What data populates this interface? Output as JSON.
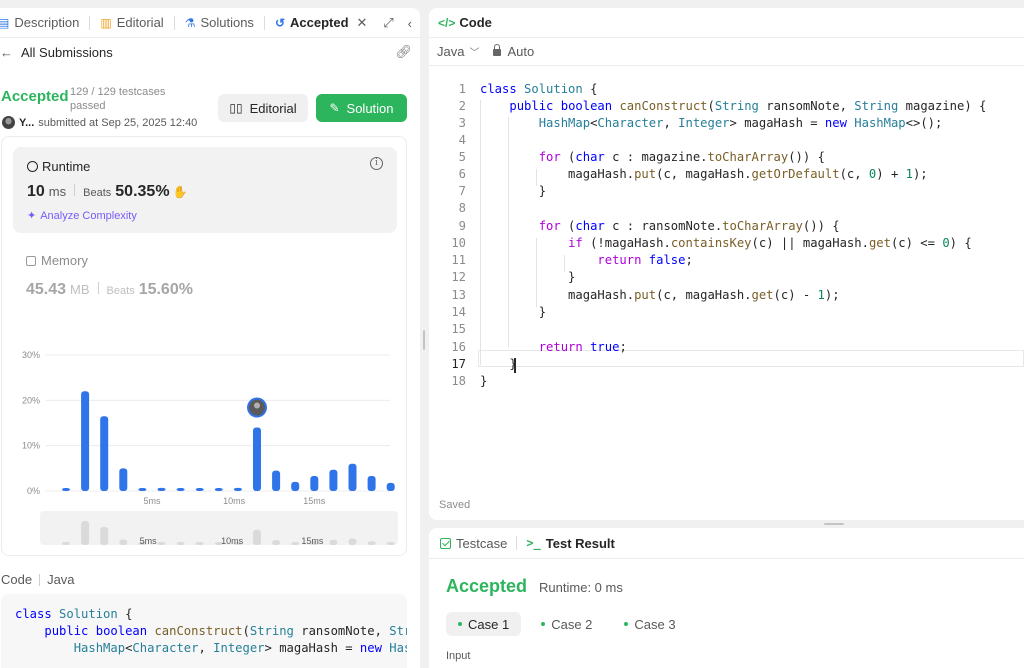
{
  "tabs": {
    "description": "Description",
    "editorial": "Editorial",
    "solutions": "Solutions",
    "accepted": "Accepted"
  },
  "submissions": {
    "back_label": "All Submissions"
  },
  "result": {
    "status": "Accepted",
    "testcases": "129 / 129 testcases passed",
    "user": "Y...",
    "submitted": "submitted at Sep 25, 2025 12:40",
    "editorial_btn": "Editorial",
    "solution_btn": "Solution"
  },
  "runtime": {
    "title": "Runtime",
    "value": "10",
    "unit": "ms",
    "beats_label": "Beats",
    "beats_pct": "50.35%",
    "analyze": "Analyze Complexity"
  },
  "memory": {
    "title": "Memory",
    "value": "45.43",
    "unit": "MB",
    "beats_label": "Beats",
    "beats_pct": "15.60%"
  },
  "chart_data": {
    "type": "bar",
    "title": "",
    "xlabel": "",
    "ylabel": "",
    "x": [
      0,
      1,
      2,
      3,
      4,
      5,
      6,
      7,
      8,
      9,
      10,
      11,
      12,
      13,
      14,
      15,
      16,
      17
    ],
    "values": [
      0.5,
      22,
      16.5,
      5,
      0.5,
      0.7,
      0.6,
      0.6,
      0.6,
      0.7,
      14,
      4.5,
      2,
      3.3,
      4.7,
      6,
      3.3,
      1.8
    ],
    "ylim": [
      0,
      30
    ],
    "ytick_labels": [
      "0%",
      "10%",
      "20%",
      "30%"
    ],
    "xtick_labels": [
      "5ms",
      "10ms",
      "15ms"
    ],
    "highlight_index": 10,
    "bar_color": "#2f74e8"
  },
  "overview_chart": {
    "xtick_labels": [
      "5ms",
      "10ms",
      "15ms"
    ]
  },
  "code_preview": {
    "label": "Code",
    "lang": "Java"
  },
  "editor": {
    "title": "Code",
    "language": "Java",
    "mode": "Auto",
    "saved": "Saved",
    "current_line": 17,
    "line_numbers": [
      "1",
      "2",
      "3",
      "4",
      "5",
      "6",
      "7",
      "8",
      "9",
      "10",
      "11",
      "12",
      "13",
      "14",
      "15",
      "16",
      "17",
      "18"
    ]
  },
  "result_panel": {
    "tab_testcase": "Testcase",
    "tab_result": "Test Result",
    "status": "Accepted",
    "runtime": "Runtime: 0 ms",
    "cases": [
      "Case 1",
      "Case 2",
      "Case 3"
    ],
    "input_label": "Input"
  },
  "colors": {
    "accent_green": "#2db55d",
    "bar_blue": "#2f74e8",
    "analyze_purple": "#7a5af8"
  }
}
